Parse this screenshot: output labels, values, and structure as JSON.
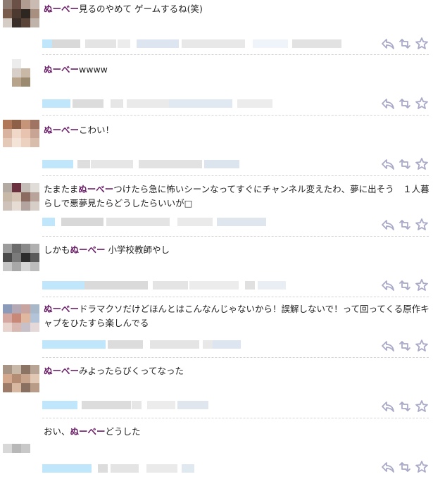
{
  "tweets": [
    {
      "before": "",
      "keyword": "ぬーべー",
      "after": "見るのやめて ゲームするね(笑)",
      "avatar_colors": [
        "#8e7b71",
        "#6a5046",
        "#b09c90",
        "#c9bbb2",
        "#7a5c4c",
        "#4c3a30",
        "#2e2620",
        "#a89080",
        "#d6ccc6",
        "#3a2e28",
        "#5a4438",
        "#c0b4aa"
      ],
      "meta_colors": [
        "#bfe6fb",
        "#d9d9d9",
        "#e4e4e4",
        "#ececec",
        "#dde6f0",
        "#e8e8e8",
        "#eef4fa",
        "#e2e2e2"
      ]
    },
    {
      "before": "",
      "keyword": "ぬーべー",
      "after": "wwww",
      "avatar_colors": [
        "#ffffff",
        "#ececec",
        "#ffffff",
        "#ffffff",
        "#ffffff",
        "#d8d0c8",
        "#c9b8a6",
        "#ffffff",
        "#ffffff",
        "#b8a48a",
        "#9c8a70",
        "#ffffff"
      ],
      "meta_colors": [
        "#bfe6fb",
        "#dcdcdc",
        "#e6e6e6",
        "#eaeaea",
        "#e0e8f2",
        "#ececec"
      ]
    },
    {
      "before": "",
      "keyword": "ぬーべー",
      "after": "こわい！",
      "avatar_colors": [
        "#b07858",
        "#8e6048",
        "#c69478",
        "#a07462",
        "#d8b4a0",
        "#f0d8c8",
        "#e8c4b0",
        "#c8a494",
        "#e4c8b8",
        "#f4e4d8",
        "#ecd0c0",
        "#d8bcac"
      ],
      "meta_colors": [
        "#bfe6fb",
        "#dedede",
        "#e6e6e6",
        "#e2e2e2",
        "#dce4ee"
      ]
    },
    {
      "before": "たまたま",
      "keyword": "ぬーべー",
      "after": "つけたら急に怖いシーンなってすぐにチャンネル変えたわ、夢に出そう １人暮らしで悪夢見たらどうしたらいいが□",
      "avatar_colors": [
        "#b4aaa4",
        "#6a3040",
        "#c4bcb6",
        "#e0dcd8",
        "#c8b8a8",
        "#d6c4b4",
        "#8c6c60",
        "#b8a49a",
        "#cfc2ba",
        "#e6dcd4",
        "#b4a4a0",
        "#d8cec8"
      ],
      "meta_colors": [
        "#bfe6fb",
        "#d8d8d8",
        "#e4e4e4",
        "#eaeaea",
        "#dfe6ee"
      ]
    },
    {
      "before": "しかも",
      "keyword": "ぬーべー",
      "after": " 小学校教師やし",
      "avatar_colors": [
        "#9c9c9c",
        "#6c6c6c",
        "#8a8a8a",
        "#b0b0b0",
        "#4a4a4a",
        "#7a7a7a",
        "#2c2c2c",
        "#5a5a5a",
        "#c6c6c6",
        "#a8a8a8",
        "#d4d4d4",
        "#bcbcbc"
      ],
      "meta_colors": [
        "#bfe6fb",
        "#dadada",
        "#e4e4e4",
        "#ececec",
        "#e0e0e0",
        "#e8eef4"
      ]
    },
    {
      "before": "",
      "keyword": "ぬーべー",
      "after": "ドラマクソだけどほんとはこんなんじゃないから！誤解しないで！って回ってくる原作キャプをひたすら楽しんでる",
      "avatar_colors": [
        "#8a9ab8",
        "#b4a8b4",
        "#c8a4a0",
        "#a8b8c8",
        "#d4a8a0",
        "#c88878",
        "#e0b8a0",
        "#b4c4d8",
        "#e8d4cc",
        "#d8b8b0",
        "#c8c0c8",
        "#e4d8d8"
      ],
      "meta_colors": [
        "#bfe6fb",
        "#dcdcdc",
        "#e4e4e4",
        "#e8e8e8",
        "#dde6f0"
      ]
    },
    {
      "before": "",
      "keyword": "ぬーべー",
      "after": "みよったらびくってなった",
      "avatar_colors": [
        "#a89484",
        "#c8b8a8",
        "#8c7464",
        "#b8a494",
        "#d4a88c",
        "#b48c74",
        "#c8a48c",
        "#e0c8b4",
        "#9c7c68",
        "#d8b8a0",
        "#8a7060",
        "#b89c88"
      ],
      "meta_colors": [
        "#bfe6fb",
        "#dcdcdc",
        "#e6e6e6",
        "#ececec",
        "#dfe6ee"
      ]
    },
    {
      "before": "おい、",
      "keyword": "ぬーべー",
      "after": "どうした",
      "avatar_colors": [
        "#ffffff",
        "#ffffff",
        "#ffffff",
        "#ffffff",
        "#ffffff",
        "#ffffff",
        "#ffffff",
        "#ffffff",
        "#d8d8d8",
        "#b8b8b8",
        "#c8c8c8",
        "#ffffff"
      ],
      "meta_colors": [
        "#bfe6fb",
        "#dcdcdc",
        "#e4e4e4",
        "#eaeaea",
        "#e0e8f0"
      ]
    }
  ],
  "actions": [
    {
      "name": "reply-icon",
      "color": "#a9a9c8"
    },
    {
      "name": "retweet-icon",
      "color": "#a9a9c8"
    },
    {
      "name": "favorite-icon",
      "color": "#a9a9c8"
    }
  ]
}
